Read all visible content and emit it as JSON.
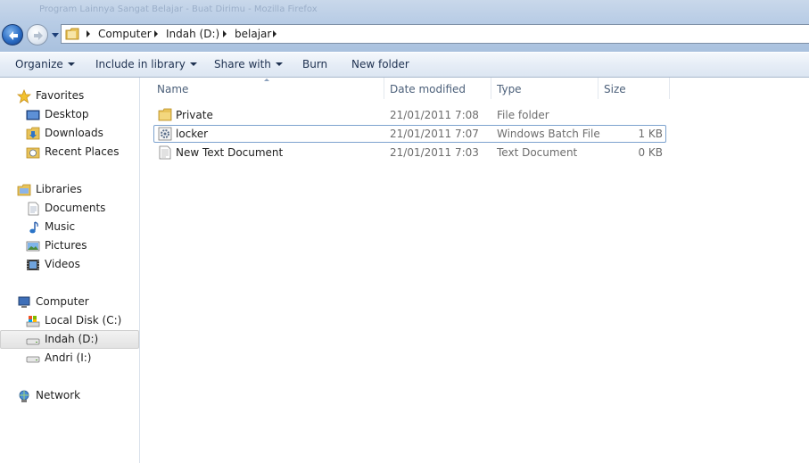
{
  "window": {
    "title": "Program Lainnya Sangat Belajar - Buat Dirimu - Mozilla Firefox"
  },
  "address": {
    "crumbs": [
      "Computer",
      "Indah (D:)",
      "belajar"
    ]
  },
  "toolbar": {
    "organize": "Organize",
    "include_in_library": "Include in library",
    "share_with": "Share with",
    "burn": "Burn",
    "new_folder": "New folder"
  },
  "nav": {
    "favorites": "Favorites",
    "desktop": "Desktop",
    "downloads": "Downloads",
    "recent_places": "Recent Places",
    "libraries": "Libraries",
    "documents": "Documents",
    "music": "Music",
    "pictures": "Pictures",
    "videos": "Videos",
    "computer": "Computer",
    "local_disk": "Local Disk (C:)",
    "indah": "Indah (D:)",
    "andri": "Andri (I:)",
    "network": "Network"
  },
  "columns": {
    "name": "Name",
    "date_modified": "Date modified",
    "type": "Type",
    "size": "Size"
  },
  "files": [
    {
      "name": "Private",
      "date": "21/01/2011 7:08",
      "type": "File folder",
      "size": ""
    },
    {
      "name": "locker",
      "date": "21/01/2011 7:07",
      "type": "Windows Batch File",
      "size": "1 KB"
    },
    {
      "name": "New Text Document",
      "date": "21/01/2011 7:03",
      "type": "Text Document",
      "size": "0 KB"
    }
  ]
}
